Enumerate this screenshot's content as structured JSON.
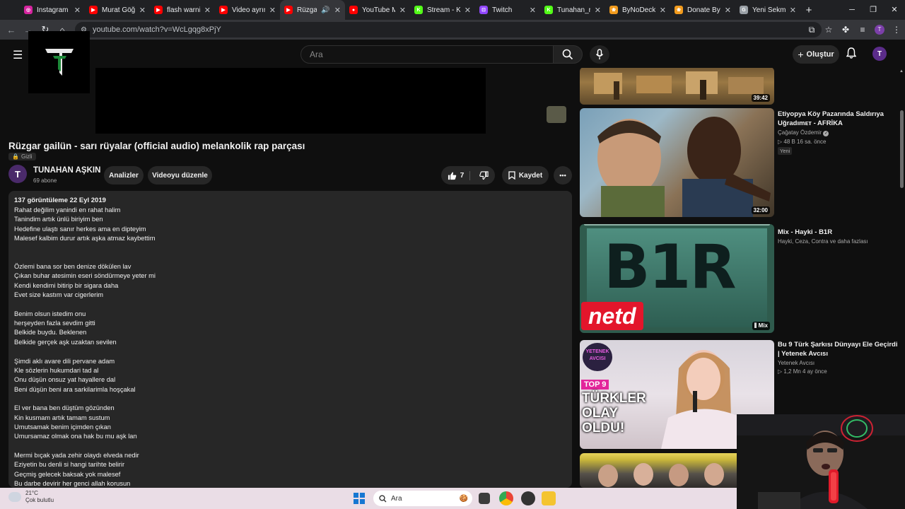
{
  "browser": {
    "tabs": [
      {
        "label": "Instagram",
        "color": "#d6249f",
        "glyph": "◎"
      },
      {
        "label": "Murat Göğe",
        "color": "#ff0000",
        "glyph": "▶"
      },
      {
        "label": "flash warnin",
        "color": "#ff0000",
        "glyph": "▶"
      },
      {
        "label": "Video ayrıntı",
        "color": "#ff0000",
        "glyph": "▶"
      },
      {
        "label": "Rüzgar g",
        "color": "#ff0000",
        "glyph": "▶"
      },
      {
        "label": "YouTube Mu",
        "color": "#ff0000",
        "glyph": "●"
      },
      {
        "label": "Stream - Kic",
        "color": "#53fc18",
        "glyph": "K"
      },
      {
        "label": "Twitch",
        "color": "#9146ff",
        "glyph": "⊡"
      },
      {
        "label": "Tunahan_ru",
        "color": "#53fc18",
        "glyph": "K"
      },
      {
        "label": "ByNoDeck il",
        "color": "#f29b1d",
        "glyph": "❀"
      },
      {
        "label": "Donate ByN",
        "color": "#f29b1d",
        "glyph": "❀"
      },
      {
        "label": "Yeni Sekme",
        "color": "#9aa0a6",
        "glyph": "G"
      }
    ],
    "new_tab": "+",
    "url": "youtube.com/watch?v=WcLgqg8xPjY",
    "profile_initial": "T"
  },
  "youtube": {
    "search_placeholder": "Ara",
    "create_label": "Oluştur",
    "avatar_initial": "T"
  },
  "video": {
    "title": "Rüzgar gailün - sarı rüyalar (official audio) melankolik rap parçası",
    "privacy": "Gizli",
    "channel_name": "TUNAHAN AŞKIN",
    "channel_subs": "69 abone",
    "channel_initial": "T",
    "analytics_label": "Analizler",
    "edit_label": "Videoyu düzenle",
    "like_count": "7",
    "save_label": "Kaydet",
    "more_label": "•••"
  },
  "description": {
    "meta": "137 görüntüleme  22 Eyl 2019",
    "lines": [
      "Rahat değilim yanindi en rahat halim",
      "Tanindim artık ünlü biriyim ben",
      "Hedefine ulaştı sanır herkes ama en dipteyim",
      "Malesef kalbim durur artık aşka atmaz kaybettim",
      "",
      "",
      "Özlemi bana sor ben denize dökülen lav",
      "Çıkan buhar atesimin eseri söndürmeye yeter mi",
      "Kendi kendimi bitirip bir sigara daha",
      "Evet size kastım var cigerlerim",
      "",
      "Benim olsun istedim  onu",
      "herşeyden fazla sevdim gitti",
      "Belkide buydu. Beklenen",
      "Belkide gerçek aşk uzaktan sevilen",
      "",
      "Şimdi aklı avare dili pervane adam",
      "Kle sözlerin hukumdari tad al",
      "Onu düşün onsuz yat hayallere dal",
      "Beni düşün beni ara sarkilarimla hoşçakal",
      "",
      "El ver bana ben düştüm gözünden",
      "Kin kusmam artık tamam  sustum",
      "Umutsamak benim içimden çıkan",
      "Umursamaz olmak ona hak bu mu aşk lan",
      "",
      "Mermi bıçak yada zehir olaydı elveda nedir",
      "Eziyetin bu denli si hangi tarihte belirir",
      "Geçmiş gelecek baksak yok malesef",
      "Bu darbe devirir her genci allah korusun"
    ]
  },
  "recommendations": [
    {
      "title": "",
      "channel": "",
      "meta": "",
      "badge": "",
      "duration": "39:42"
    },
    {
      "title": "Etiyopya Köy Pazarında Saldırıya Uğradımᴇᴛ - AFRİKA",
      "channel": "Çağatay Özdemir",
      "meta": "48 B  16 sa. önce",
      "badge": "Yeni",
      "duration": "32:00"
    },
    {
      "title": "Mix - Hayki - B1R",
      "channel": "Hayki, Ceza, Contra ve daha fazlası",
      "meta": "",
      "badge": "",
      "duration": "Mix",
      "thumb_text": "B1R",
      "thumb_brand": "netd"
    },
    {
      "title": "Bu 9 Türk Şarkısı Dünyayı Ele Geçirdi | Yetenek Avcısı",
      "channel": "Yetenek Avcısı",
      "meta": "1,2 Mn  4 ay önce",
      "badge": "",
      "duration": "",
      "thumb_text": "TÜRKLER OLAY OLDU!",
      "thumb_tag": "TOP 9",
      "thumb_logo": "YETENEK AVCISI"
    }
  ],
  "taskbar": {
    "temperature": "21°C",
    "weather": "Çok bulutlu",
    "search_placeholder": "Ara"
  }
}
